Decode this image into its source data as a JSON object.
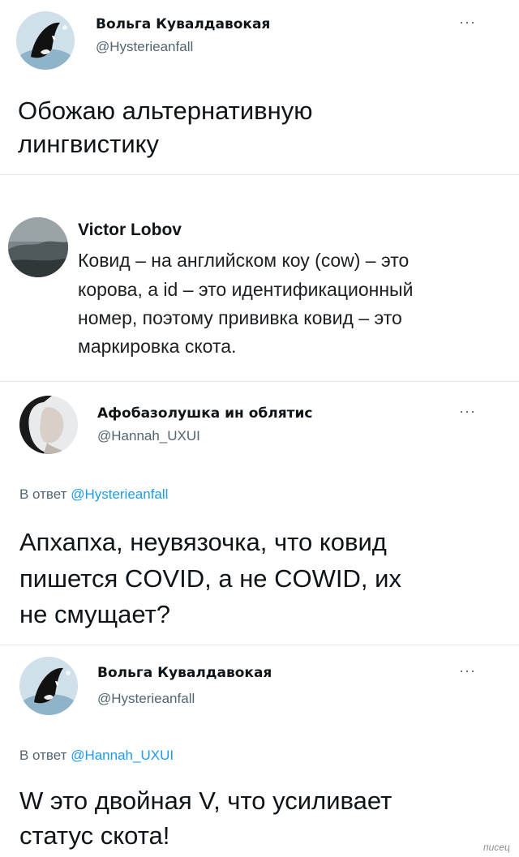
{
  "tweet1": {
    "name": "Вольга Кувалдавокая",
    "handle": "@Hysterieanfall",
    "text_line1": "Обожаю альтернативную",
    "text_line2": "лингвистику"
  },
  "quote": {
    "name": "Victor Lobov",
    "lines": [
      "Ковид – на английском коу (cow) – это",
      "корова, а id – это идентификационный",
      "номер, поэтому прививка ковид – это",
      "маркировка скота."
    ]
  },
  "tweet2": {
    "name": "Афобазолушка ин облятис",
    "handle": "@Hannah_UXUI",
    "reply_prefix": "В ответ",
    "reply_to": "@Hysterieanfall",
    "text_line1": "Апхапха, неувязочка, что ковид",
    "text_line2": "пишется COVID, а не COWID, их",
    "text_line3": "не смущает?"
  },
  "tweet3": {
    "name": "Вольга Кувалдавокая",
    "handle": "@Hysterieanfall",
    "reply_prefix": "В ответ",
    "reply_to": "@Hannah_UXUI",
    "text_line1": "W это двойная V, что усиливает",
    "text_line2": "статус скота!"
  },
  "watermark": "писец",
  "more_icon": "more-dots",
  "colors": {
    "text": "#0f1419",
    "secondary": "#536471",
    "link": "#1d9bf0"
  }
}
